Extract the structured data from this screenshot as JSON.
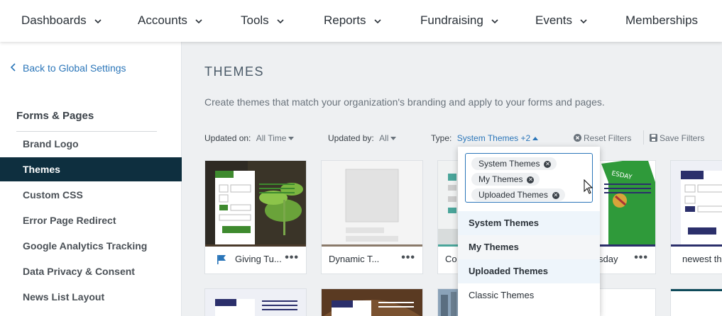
{
  "nav": {
    "items": [
      {
        "label": "Dashboards",
        "has_dropdown": true
      },
      {
        "label": "Accounts",
        "has_dropdown": true
      },
      {
        "label": "Tools",
        "has_dropdown": true
      },
      {
        "label": "Reports",
        "has_dropdown": true
      },
      {
        "label": "Fundraising",
        "has_dropdown": true
      },
      {
        "label": "Events",
        "has_dropdown": true
      },
      {
        "label": "Memberships",
        "has_dropdown": false
      }
    ]
  },
  "sidebar": {
    "back_label": "Back to Global Settings",
    "section_title": "Forms & Pages",
    "items": [
      {
        "label": "Brand Logo",
        "active": false
      },
      {
        "label": "Themes",
        "active": true
      },
      {
        "label": "Custom CSS",
        "active": false
      },
      {
        "label": "Error Page Redirect",
        "active": false
      },
      {
        "label": "Google Analytics Tracking",
        "active": false
      },
      {
        "label": "Data Privacy & Consent",
        "active": false
      },
      {
        "label": "News List Layout",
        "active": false
      }
    ]
  },
  "main": {
    "title": "THEMES",
    "description": "Create themes that match your organization's branding and apply to your forms and pages."
  },
  "filters": {
    "updated_on_label": "Updated on:",
    "updated_on_value": "All Time",
    "updated_by_label": "Updated by:",
    "updated_by_value": "All",
    "type_label": "Type:",
    "type_value": "System Themes +2",
    "reset_label": "Reset Filters",
    "save_label": "Save Filters"
  },
  "type_dropdown": {
    "selected_chips": [
      "System Themes",
      "My Themes",
      "Uploaded Themes"
    ],
    "options": [
      {
        "label": "System Themes",
        "selected": true
      },
      {
        "label": "My Themes",
        "selected": true
      },
      {
        "label": "Uploaded Themes",
        "selected": true
      },
      {
        "label": "Classic Themes",
        "selected": false
      }
    ]
  },
  "cards": [
    {
      "label": "Giving Tu...",
      "icon": "flag-icon"
    },
    {
      "label": "Dynamic T...",
      "icon": ""
    },
    {
      "label": "Co",
      "icon": ""
    },
    {
      "label": "sday",
      "icon": ""
    },
    {
      "label": "newest th",
      "icon": ""
    }
  ],
  "colors": {
    "active_sidebar": "#0e2f3f",
    "link": "#2b76b9",
    "green": "#3e8a2e",
    "navy": "#2b2f6b"
  }
}
